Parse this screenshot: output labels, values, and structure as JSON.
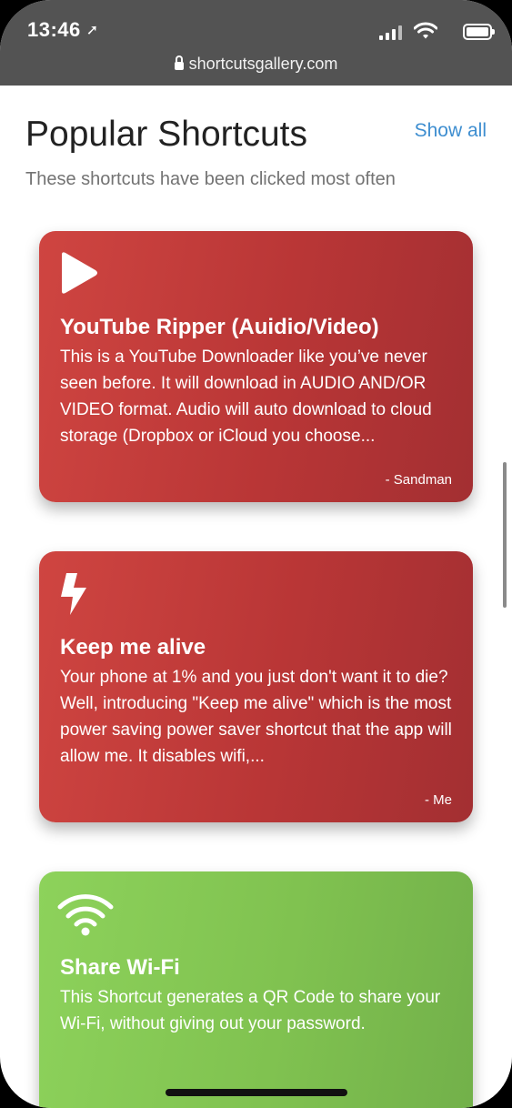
{
  "status_bar": {
    "time": "13:46",
    "location_icon": "location-arrow-icon",
    "url": "shortcutsgallery.com"
  },
  "section": {
    "title": "Popular Shortcuts",
    "show_all": "Show all",
    "subtitle": "These shortcuts have been clicked most often"
  },
  "cards": [
    {
      "icon": "play-icon",
      "color": "#c03a38",
      "title": "YouTube Ripper (Auidio/Video)",
      "description": "This is a YouTube Downloader like you’ve never seen before. It will download in AUDIO AND/OR VIDEO format. Audio will auto download to cloud storage (Dropbox or iCloud you choose...",
      "author": "- Sandman"
    },
    {
      "icon": "lightning-bolt-icon",
      "color": "#c03a38",
      "title": "Keep me alive",
      "description": "Your phone at 1% and you just don't want it to die? Well, introducing \"Keep me alive\" which is the most power saving power saver shortcut that the app will allow me. It disables wifi,...",
      "author": "- Me"
    },
    {
      "icon": "wifi-icon",
      "color": "#82c452",
      "title": "Share Wi-Fi",
      "description": "This Shortcut generates a QR Code to share your Wi-Fi, without giving out your password.",
      "author": ""
    }
  ],
  "colors": {
    "accent": "#3e8ed0",
    "status_bar_bg": "#535353"
  }
}
